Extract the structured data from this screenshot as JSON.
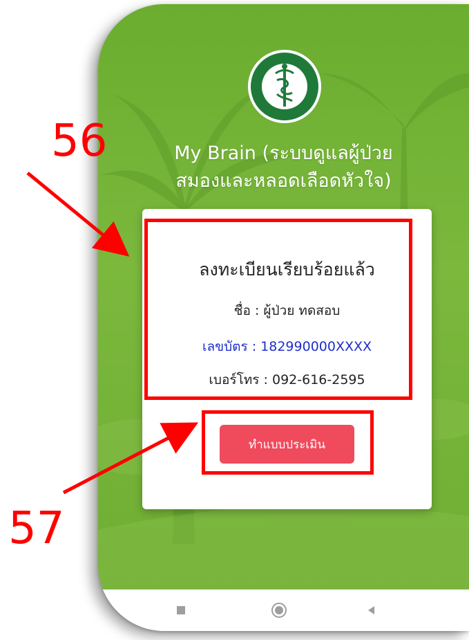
{
  "app": {
    "title_line1": "My Brain (ระบบดูแลผู้ป่วย",
    "title_line2": "สมองและหลอดเลือดหัวใจ)",
    "logo_icon": "ministry-of-public-health-seal-icon"
  },
  "card": {
    "heading": "ลงทะเบียนเรียบร้อยแล้ว",
    "name_line": "ชื่อ : ผู้ป่วย ทดสอบ",
    "id_line": "เลขบัตร : 182990000XXXX",
    "phone_line": "เบอร์โทร : 092-616-2595",
    "button_label": "ทำแบบประเมิน"
  },
  "navbar": {
    "recent_icon": "square-recent-apps-icon",
    "home_icon": "circle-home-icon",
    "back_icon": "triangle-back-icon"
  },
  "annotations": {
    "label_56": "56",
    "label_57": "57"
  },
  "colors": {
    "screen_green": "#79b63c",
    "button_red": "#f04a5d",
    "id_blue": "#1f2fc9",
    "annotation_red": "#ff0000"
  }
}
